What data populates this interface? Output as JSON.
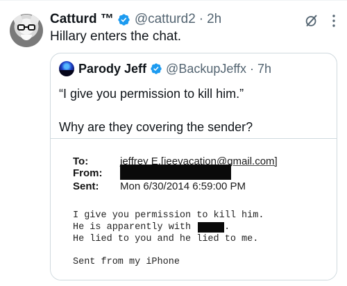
{
  "tweet": {
    "author_name": "Catturd ™",
    "handle": "@catturd2",
    "time": "2h",
    "text": "Hillary enters the chat.",
    "verified_color": "#1d9bf0"
  },
  "quoted_tweet": {
    "author_name": "Parody Jeff",
    "handle": "@BackupJeffx",
    "time": "7h",
    "text_line1": "“I give you permission to kill him.”",
    "text_line2": "Why are they covering the sender?"
  },
  "email_image": {
    "to_label": "To:",
    "to_value": "jeffrey E.[jeevacation@gmail.com]",
    "from_label": "From:",
    "sent_label": "Sent:",
    "sent_value": "Mon 6/30/2014 6:59:00 PM",
    "body_line1": "I give you permission to kill him.",
    "body_line2_prefix": "He is apparently with",
    "body_line2_suffix": ".",
    "body_line3": "He lied to you and he lied to me.",
    "signature": "Sent from my iPhone"
  },
  "icons": {
    "grok": "grok-icon",
    "more": "more-options-icon",
    "verified": "verified-badge-icon"
  },
  "colors": {
    "text_primary": "#0f1419",
    "text_secondary": "#536471",
    "border": "#cfd9de",
    "accent": "#1d9bf0",
    "redaction": "#0a0a0a"
  }
}
